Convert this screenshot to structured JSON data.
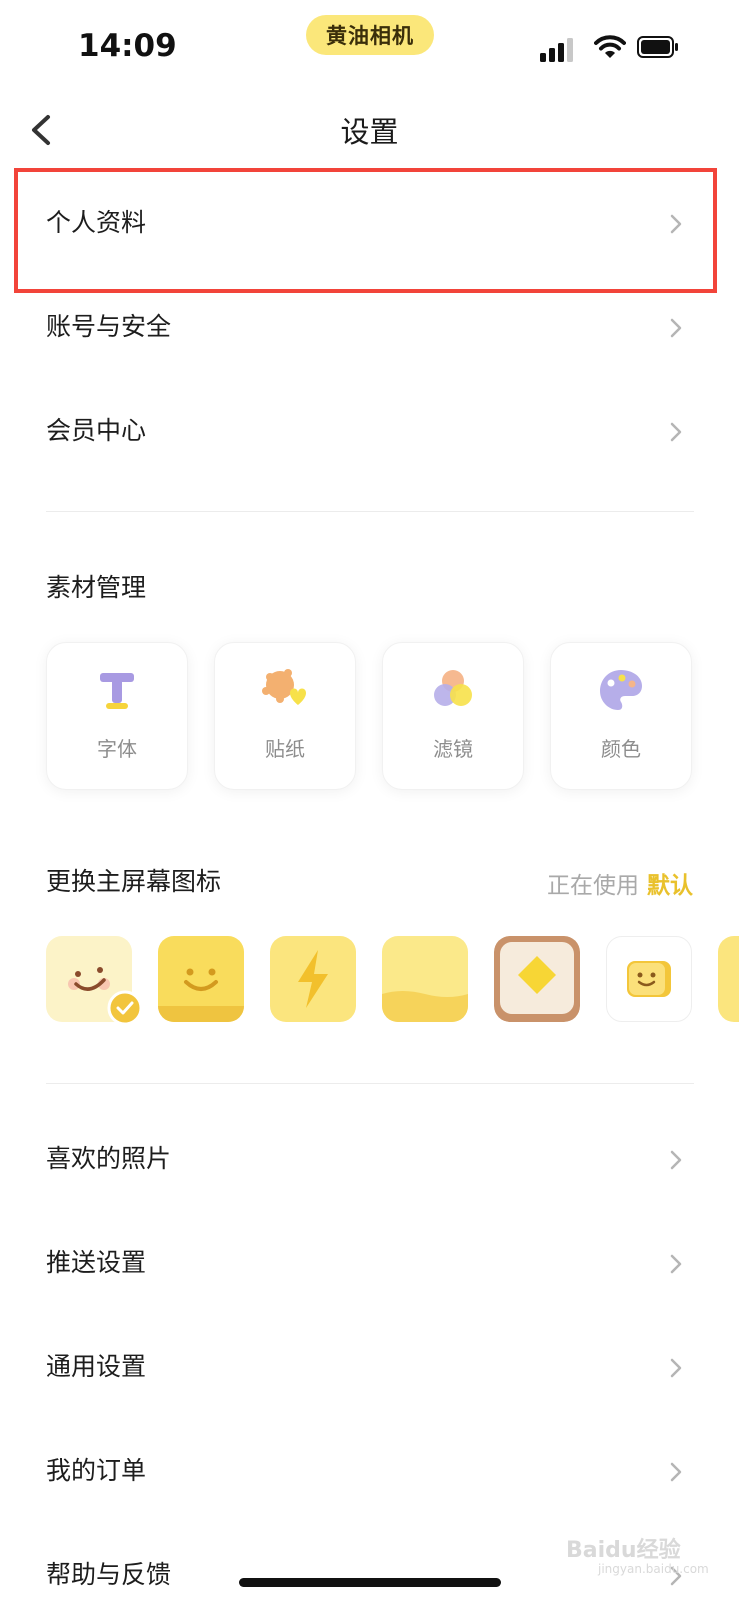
{
  "status_bar": {
    "time": "14:09",
    "app_name": "黄油相机"
  },
  "nav": {
    "title": "设置"
  },
  "account_items": [
    {
      "label": "个人资料"
    },
    {
      "label": "账号与安全"
    },
    {
      "label": "会员中心"
    }
  ],
  "materials": {
    "title": "素材管理",
    "items": [
      {
        "label": "字体",
        "icon": "font-icon"
      },
      {
        "label": "贴纸",
        "icon": "sticker-icon"
      },
      {
        "label": "滤镜",
        "icon": "filter-icon"
      },
      {
        "label": "颜色",
        "icon": "palette-icon"
      }
    ]
  },
  "home_icon": {
    "title": "更换主屏幕图标",
    "using_label": "正在使用",
    "current_value": "默认",
    "options": [
      {
        "name": "default-smile-icon",
        "selected": true
      },
      {
        "name": "yellow-smile-icon",
        "selected": false
      },
      {
        "name": "lightning-icon",
        "selected": false
      },
      {
        "name": "butter-block-icon",
        "selected": false
      },
      {
        "name": "toast-icon",
        "selected": false
      },
      {
        "name": "camera-smile-icon",
        "selected": false
      },
      {
        "name": "partial-icon",
        "selected": false
      }
    ]
  },
  "more_items": [
    {
      "label": "喜欢的照片"
    },
    {
      "label": "推送设置"
    },
    {
      "label": "通用设置"
    },
    {
      "label": "我的订单"
    },
    {
      "label": "帮助与反馈"
    }
  ],
  "watermark": {
    "text": "Baidu经验",
    "subtext": "jingyan.baidu.com"
  },
  "colors": {
    "accent": "#e9c12c",
    "highlight": "#f2443a",
    "pill": "#fbe77a"
  }
}
